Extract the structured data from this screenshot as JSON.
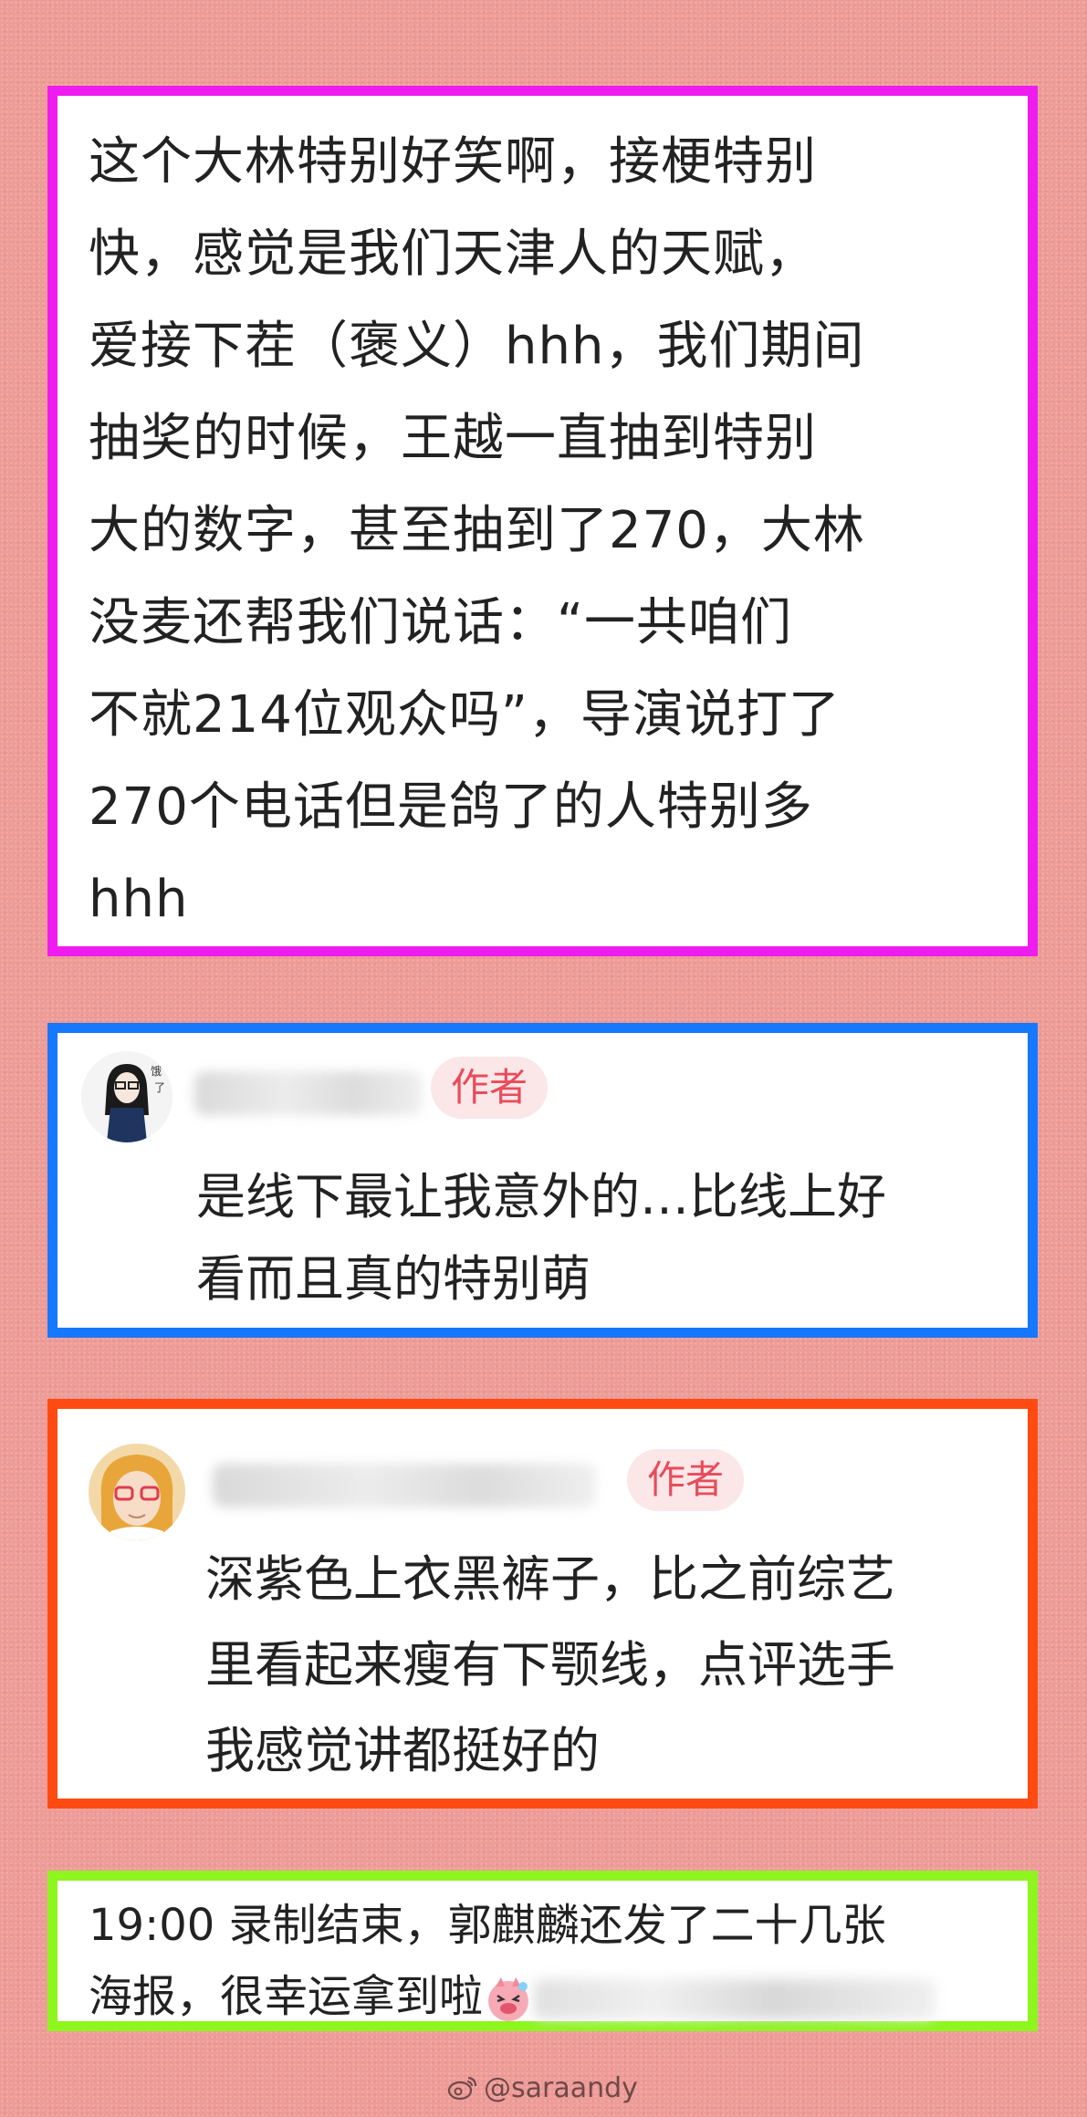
{
  "post": {
    "lines": [
      "这个大林特别好笑啊，接梗特别",
      "快，感觉是我们天津人的天赋，",
      "爱接下茬（褒义）hhh，我们期间",
      "抽奖的时候，王越一直抽到特别",
      "大的数字，甚至抽到了270，大林",
      "没麦还帮我们说话：“一共咱们",
      "不就214位观众吗”，导演说打了",
      "270个电话但是鸽了的人特别多",
      "hhh"
    ]
  },
  "reply1": {
    "badge": "作者",
    "lines": [
      "是线下最让我意外的…比线上好",
      "看而且真的特别萌"
    ]
  },
  "reply2": {
    "badge": "作者",
    "lines": [
      "深紫色上衣黑裤子，比之前综艺",
      "里看起来瘦有下颚线，点评选手",
      "我感觉讲都挺好的"
    ]
  },
  "note": {
    "line1": "19:00 录制结束，郭麒麟还发了二十几张",
    "line2": "海报，很幸运拿到啦"
  },
  "watermark": {
    "handle": "@saraandy",
    "icon": "weibo-icon"
  },
  "colors": {
    "background": "#ee9c98",
    "card1_border": "#ee1cee",
    "card2_border": "#1677ff",
    "card3_border": "#ff4a12",
    "card4_border": "#8ef51f",
    "badge_text": "#e84c5a",
    "badge_bg": "#fbe6e8"
  }
}
